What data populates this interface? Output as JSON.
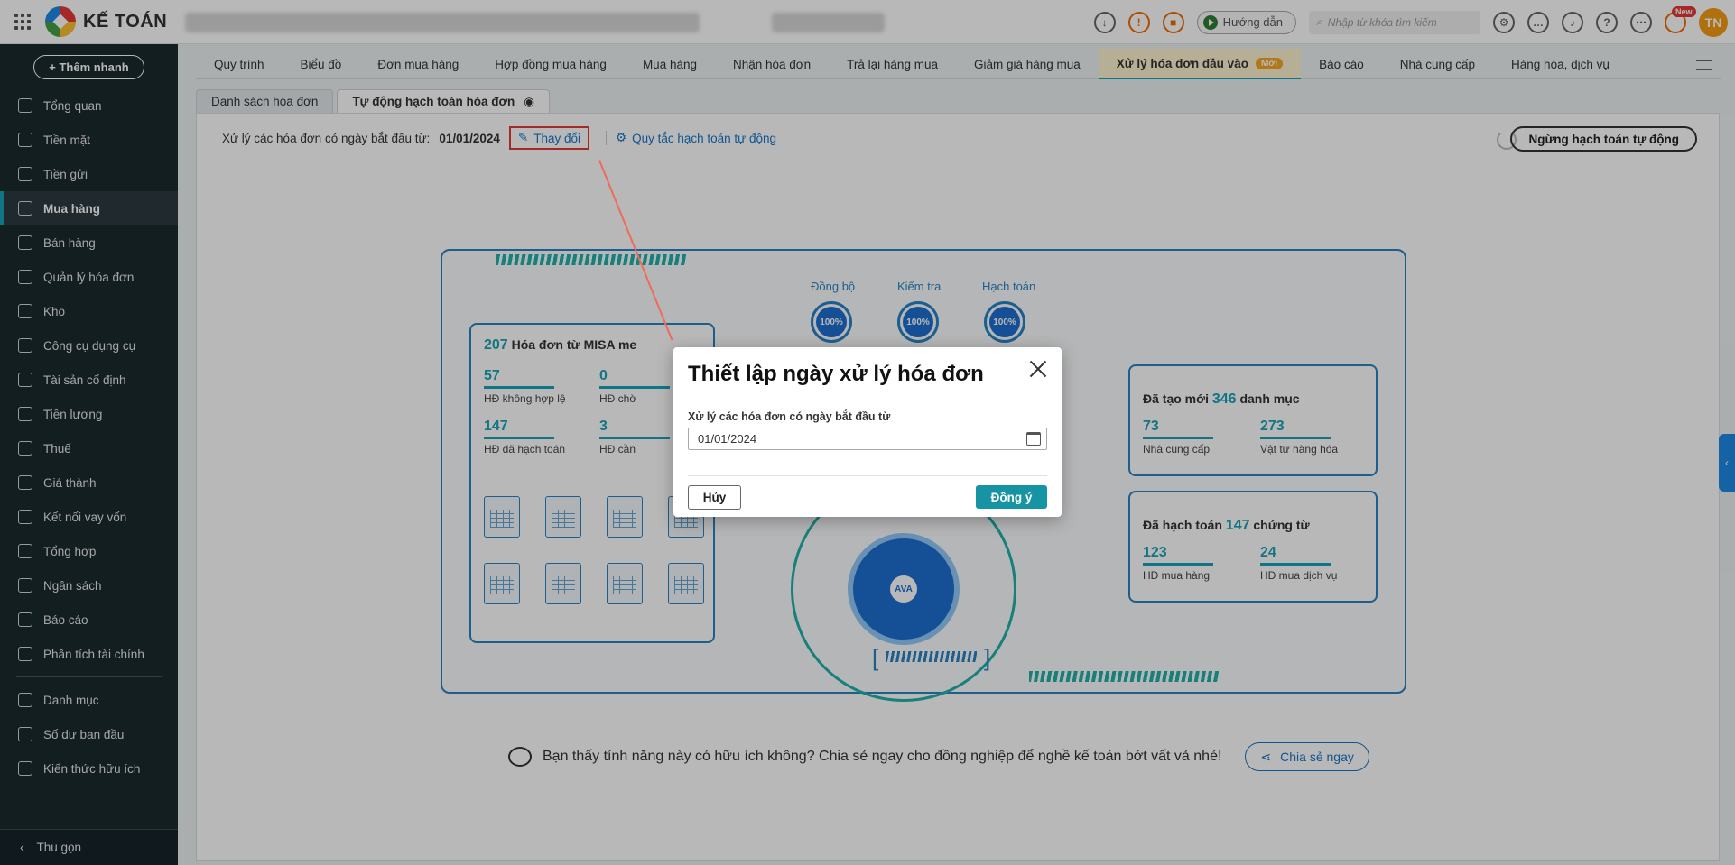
{
  "header": {
    "app_name": "KẾ TOÁN",
    "guide_label": "Hướng dẫn",
    "search_placeholder": "Nhập từ khóa tìm kiếm",
    "new_badge": "New",
    "avatar_initials": "TN"
  },
  "sidebar": {
    "quick_add": "+ Thêm nhanh",
    "items": [
      {
        "label": "Tổng quan",
        "icon": "chart-pie-icon"
      },
      {
        "label": "Tiền mặt",
        "icon": "money-bag-icon"
      },
      {
        "label": "Tiền gửi",
        "icon": "bank-icon"
      },
      {
        "label": "Mua hàng",
        "icon": "shopping-bag-icon",
        "active": true
      },
      {
        "label": "Bán hàng",
        "icon": "cart-icon"
      },
      {
        "label": "Quản lý hóa đơn",
        "icon": "invoice-icon"
      },
      {
        "label": "Kho",
        "icon": "warehouse-icon"
      },
      {
        "label": "Công cụ dụng cụ",
        "icon": "tools-icon"
      },
      {
        "label": "Tài sản cố định",
        "icon": "car-icon"
      },
      {
        "label": "Tiền lương",
        "icon": "payroll-icon"
      },
      {
        "label": "Thuế",
        "icon": "tax-icon"
      },
      {
        "label": "Giá thành",
        "icon": "tag-icon"
      },
      {
        "label": "Kết nối vay vốn",
        "icon": "loan-icon"
      },
      {
        "label": "Tổng hợp",
        "icon": "summary-icon"
      },
      {
        "label": "Ngân sách",
        "icon": "budget-icon"
      },
      {
        "label": "Báo cáo",
        "icon": "report-icon"
      },
      {
        "label": "Phân tích tài chính",
        "icon": "analysis-icon"
      }
    ],
    "items2": [
      {
        "label": "Danh mục",
        "icon": "list-icon"
      },
      {
        "label": "Số dư ban đầu",
        "icon": "balance-icon"
      },
      {
        "label": "Kiến thức hữu ích",
        "icon": "knowledge-icon"
      }
    ],
    "collapse_label": "Thu gọn"
  },
  "tabs": [
    {
      "label": "Quy trình"
    },
    {
      "label": "Biểu đồ"
    },
    {
      "label": "Đơn mua hàng"
    },
    {
      "label": "Hợp đồng mua hàng"
    },
    {
      "label": "Mua hàng"
    },
    {
      "label": "Nhận hóa đơn"
    },
    {
      "label": "Trả lại hàng mua"
    },
    {
      "label": "Giảm giá hàng mua"
    },
    {
      "label": "Xử lý hóa đơn đầu vào",
      "badge": "Mới",
      "active": true
    },
    {
      "label": "Báo cáo"
    },
    {
      "label": "Nhà cung cấp"
    },
    {
      "label": "Hàng hóa, dịch vụ"
    }
  ],
  "subtabs": {
    "list": "Danh sách hóa đơn",
    "auto": "Tự động hạch toán hóa đơn"
  },
  "process": {
    "text": "Xử lý các hóa đơn có ngày bắt đầu từ:",
    "date": "01/01/2024",
    "change": "Thay đổi",
    "rules": "Quy tắc hạch toán tự động",
    "stop": "Ngừng hạch toán tự động"
  },
  "dashboard": {
    "invoice_count": "207",
    "invoice_title": "Hóa đơn từ MISA me",
    "stats": [
      {
        "num": "57",
        "label": "HĐ không hợp lệ"
      },
      {
        "num": "0",
        "label": "HĐ chờ"
      },
      {
        "num": "147",
        "label": "HĐ đã hạch toán"
      },
      {
        "num": "3",
        "label": "HĐ cần"
      }
    ],
    "doc_label": "Hóa đơn",
    "steps": [
      {
        "label": "Đồng bộ",
        "pct": "100%"
      },
      {
        "label": "Kiểm tra",
        "pct": "100%"
      },
      {
        "label": "Hạch toán",
        "pct": "100%"
      }
    ],
    "core_label": "AVA",
    "card1": {
      "pre": "Đã tạo mới",
      "num": "346",
      "post": "danh mục",
      "stats": [
        {
          "num": "73",
          "label": "Nhà cung cấp"
        },
        {
          "num": "273",
          "label": "Vật tư hàng hóa"
        }
      ]
    },
    "card2": {
      "pre": "Đã hạch toán",
      "num": "147",
      "post": "chứng từ",
      "stats": [
        {
          "num": "123",
          "label": "HĐ mua hàng"
        },
        {
          "num": "24",
          "label": "HĐ mua dịch vụ"
        }
      ]
    }
  },
  "share": {
    "text": "Bạn thấy tính năng này có hữu ích không? Chia sẻ ngay cho đồng nghiệp để nghề kế toán bớt vất vả nhé!",
    "button": "Chia sẻ ngay"
  },
  "modal": {
    "title": "Thiết lập ngày xử lý hóa đơn",
    "field_label": "Xử lý các hóa đơn có ngày bắt đầu từ",
    "field_value": "01/01/2024",
    "cancel": "Hủy",
    "ok": "Đồng ý"
  }
}
